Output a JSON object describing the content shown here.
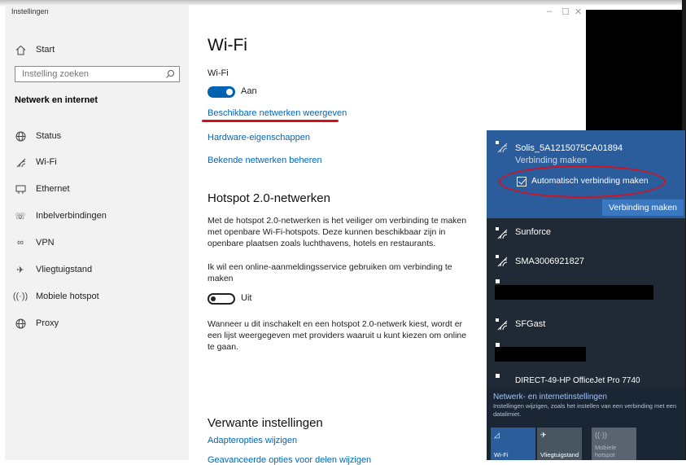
{
  "window": {
    "title": "Instellingen",
    "controls": [
      "–",
      "☐",
      "✕"
    ]
  },
  "sidebar": {
    "home_label": "Start",
    "search_placeholder": "Instelling zoeken",
    "group_title": "Netwerk en internet",
    "items": [
      {
        "label": "Status",
        "icon": "globe-icon"
      },
      {
        "label": "Wi-Fi",
        "icon": "wifi-icon"
      },
      {
        "label": "Ethernet",
        "icon": "ethernet-icon"
      },
      {
        "label": "Inbelverbindingen",
        "icon": "phone-icon"
      },
      {
        "label": "VPN",
        "icon": "vpn-icon"
      },
      {
        "label": "Vliegtuigstand",
        "icon": "airplane-icon"
      },
      {
        "label": "Mobiele hotspot",
        "icon": "hotspot-icon"
      },
      {
        "label": "Proxy",
        "icon": "globe-icon"
      }
    ]
  },
  "main": {
    "title": "Wi-Fi",
    "wifi_label": "Wi-Fi",
    "wifi_state": "Aan",
    "link_show_networks": "Beschikbare netwerken weergeven",
    "link_hardware": "Hardware-eigenschappen",
    "link_known": "Bekende netwerken beheren",
    "hotspot_title": "Hotspot 2.0-netwerken",
    "hotspot_desc": "Met de hotspot 2.0-netwerken is het veiliger om verbinding te maken met openbare Wi-Fi-hotspots. Deze kunnen beschikbaar zijn in openbare plaatsen zoals luchthavens, hotels en restaurants.",
    "online_service_label": "Ik wil een online-aanmeldingsservice gebruiken om verbinding te maken",
    "online_service_state": "Uit",
    "online_service_desc": "Wanneer u dit inschakelt en een hotspot 2.0-netwerk kiest, wordt er een lijst weergegeven met providers waaruit u kunt kiezen om online te gaan.",
    "related_title": "Verwante instellingen",
    "link_adapter": "Adapteropties wijzigen",
    "link_sharing": "Geavanceerde opties voor delen wijzigen"
  },
  "flyout": {
    "selected_network": "Solis_5A1215075CA01894",
    "selected_status": "Verbinding maken",
    "auto_connect_label": "Automatisch verbinding maken",
    "auto_connect_checked": true,
    "connect_button": "Verbinding maken",
    "networks": [
      "Sunforce",
      "SMA3006921827",
      "SFGast",
      "DIRECT-49-HP OfficeJet Pro 7740"
    ],
    "settings_link": "Netwerk- en internetinstellingen",
    "settings_desc": "Instellingen wijzigen, zoals het instellen van een verbinding met een datalimiet.",
    "tiles": [
      {
        "label": "Wi-Fi",
        "icon": "wifi-icon",
        "active": true
      },
      {
        "label": "Vliegtuigstand",
        "icon": "airplane-icon",
        "active": false
      },
      {
        "label": "Mobiele hotspot",
        "icon": "hotspot-icon",
        "active": false
      }
    ]
  },
  "colors": {
    "accent": "#0067b8",
    "annotation_red": "#d6111f",
    "flyout_bg": "#1f2a36",
    "flyout_selected": "#2b5d9c"
  }
}
